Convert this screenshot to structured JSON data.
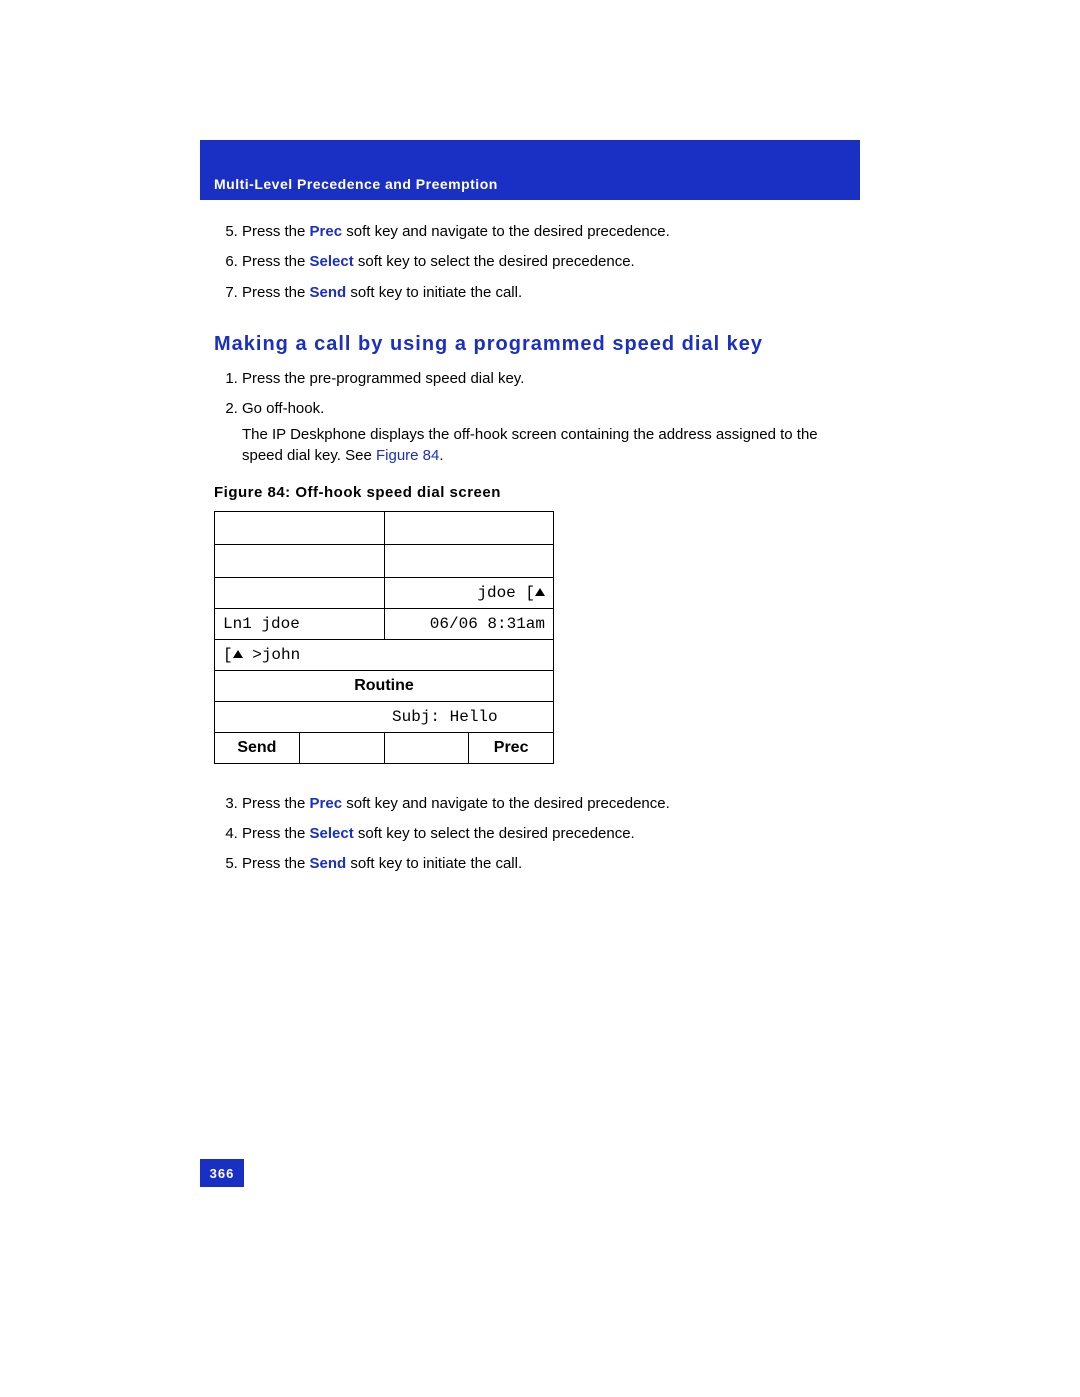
{
  "header": {
    "title": "Multi-Level Precedence and Preemption"
  },
  "topSteps": {
    "start": 5,
    "items": [
      {
        "pre": "Press the ",
        "kw": "Prec",
        "post": " soft key and navigate to the desired precedence."
      },
      {
        "pre": "Press the ",
        "kw": "Select",
        "post": " soft key to select the desired precedence."
      },
      {
        "pre": "Press the ",
        "kw": "Send",
        "post": " soft key to initiate the call."
      }
    ]
  },
  "section": {
    "heading": "Making a call by using a programmed speed dial key"
  },
  "midSteps": {
    "start": 1,
    "item1": "Press the pre-programmed speed dial key.",
    "item2": "Go off-hook.",
    "item2_followA": "The IP Deskphone displays the off-hook screen containing the address assigned to the speed dial key. See ",
    "item2_followLink": "Figure 84",
    "item2_followB": "."
  },
  "figure": {
    "caption": "Figure 84: Off-hook speed dial screen"
  },
  "phone": {
    "r3_right_pre": "jdoe ",
    "r4_left": "Ln1 jdoe",
    "r4_right": "06/06 8:31am",
    "r5_left_mid": " >john",
    "r6_center": "Routine",
    "r7_right": "Subj: Hello",
    "sk1": "Send",
    "sk2": "",
    "sk3": "",
    "sk4": "Prec"
  },
  "bottomSteps": {
    "start": 3,
    "items": [
      {
        "pre": "Press the ",
        "kw": "Prec",
        "post": " soft key and navigate to the desired precedence."
      },
      {
        "pre": "Press the ",
        "kw": "Select",
        "post": " soft key to select the desired precedence."
      },
      {
        "pre": "Press the ",
        "kw": "Send",
        "post": " soft key to initiate the call."
      }
    ]
  },
  "pageNumber": "366"
}
